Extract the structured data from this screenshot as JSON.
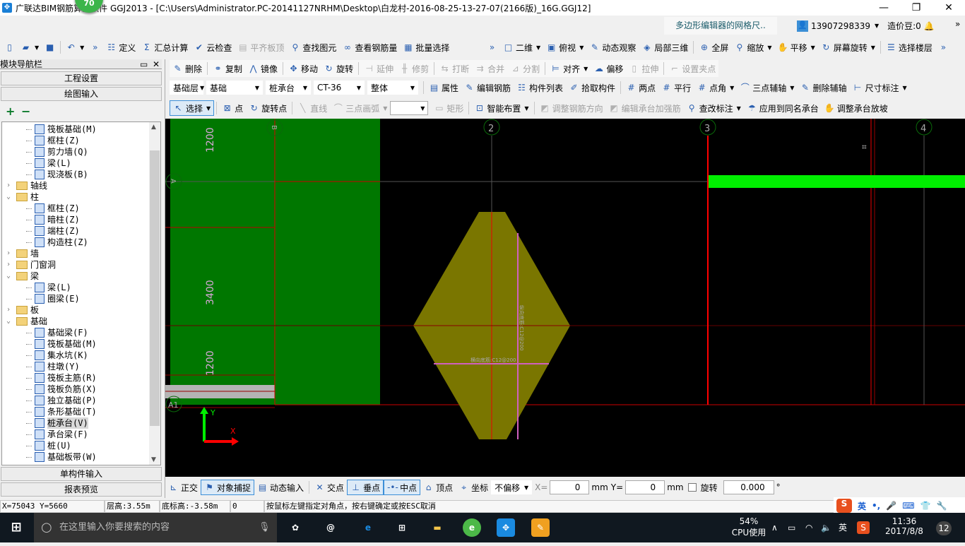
{
  "window": {
    "title": "广联达BIM钢筋算量软件 GGJ2013 - [C:\\Users\\Administrator.PC-20141127NRHM\\Desktop\\白龙村-2016-08-25-13-27-07(2166版)_16G.GGJ12]",
    "badge": "70",
    "minimize": "—",
    "restore": "❐",
    "close": "✕"
  },
  "header": {
    "notice": "多边形编辑器的网格尺..",
    "user": "13907298339",
    "beans": "造价豆:0",
    "more": "»"
  },
  "toolbar1": [
    {
      "id": "new",
      "icon": "▯"
    },
    {
      "id": "open",
      "icon": "▰",
      "dd": true
    },
    {
      "id": "save",
      "icon": "■"
    },
    {
      "sep": true
    },
    {
      "id": "undo",
      "icon": "↶",
      "dd": true
    },
    {
      "id": "more",
      "icon": "»"
    },
    {
      "label": "定义",
      "icon": "☷"
    },
    {
      "label": "汇总计算",
      "icon": "Σ"
    },
    {
      "label": "云检查",
      "icon": "✔"
    },
    {
      "label": "平齐板顶",
      "icon": "▤",
      "dis": true
    },
    {
      "label": "查找图元",
      "icon": "⚲"
    },
    {
      "label": "查看钢筋量",
      "icon": "∞"
    },
    {
      "label": "批量选择",
      "icon": "▦"
    }
  ],
  "toolbar1b": [
    {
      "id": "more",
      "icon": "»"
    },
    {
      "label": "二维",
      "icon": "□",
      "dd": true
    },
    {
      "label": "俯视",
      "icon": "▣",
      "dd": true
    },
    {
      "label": "动态观察",
      "icon": "✎"
    },
    {
      "label": "局部三维",
      "icon": "◈"
    },
    {
      "sep": true
    },
    {
      "label": "全屏",
      "icon": "⊕"
    },
    {
      "label": "缩放",
      "icon": "⚲",
      "dd": true
    },
    {
      "label": "平移",
      "icon": "✋",
      "dd": true
    },
    {
      "label": "屏幕旋转",
      "icon": "↻",
      "dd": true
    },
    {
      "sep": true
    },
    {
      "label": "选择楼层",
      "icon": "☰"
    },
    {
      "id": "more2",
      "icon": "»"
    }
  ],
  "toolbar2": [
    {
      "label": "删除",
      "icon": "✎"
    },
    {
      "sep": true
    },
    {
      "label": "复制",
      "icon": "⚭"
    },
    {
      "label": "镜像",
      "icon": "⋀"
    },
    {
      "sep": true
    },
    {
      "label": "移动",
      "icon": "✥"
    },
    {
      "label": "旋转",
      "icon": "↻"
    },
    {
      "sep": true
    },
    {
      "label": "延伸",
      "icon": "⊣",
      "dis": true
    },
    {
      "label": "修剪",
      "icon": "╫",
      "dis": true
    },
    {
      "sep": true
    },
    {
      "label": "打断",
      "icon": "⇆",
      "dis": true
    },
    {
      "label": "合并",
      "icon": "⇉",
      "dis": true
    },
    {
      "label": "分割",
      "icon": "⊿",
      "dis": true
    },
    {
      "sep": true
    },
    {
      "label": "对齐",
      "icon": "⊨",
      "dd": true
    },
    {
      "label": "偏移",
      "icon": "☁"
    },
    {
      "label": "拉伸",
      "icon": "▯",
      "dis": true
    },
    {
      "sep": true
    },
    {
      "label": "设置夹点",
      "icon": "⌐",
      "dis": true
    }
  ],
  "selects3": [
    "基础层",
    "基础",
    "桩承台",
    "CT-36",
    "整体"
  ],
  "toolbar3": [
    {
      "label": "属性",
      "icon": "▤"
    },
    {
      "label": "编辑钢筋",
      "icon": "✎"
    },
    {
      "label": "构件列表",
      "icon": "☷"
    },
    {
      "label": "拾取构件",
      "icon": "✐"
    },
    {
      "sep": true
    },
    {
      "label": "两点",
      "icon": "#"
    },
    {
      "label": "平行",
      "icon": "#"
    },
    {
      "label": "点角",
      "icon": "#",
      "dd": true
    },
    {
      "label": "三点辅轴",
      "icon": "⌒",
      "dd": true
    },
    {
      "label": "删除辅轴",
      "icon": "✎"
    },
    {
      "label": "尺寸标注",
      "icon": "⊢",
      "dd": true
    }
  ],
  "toolbar4": [
    {
      "label": "选择",
      "icon": "↖",
      "dd": true,
      "on": true
    },
    {
      "sep": true
    },
    {
      "label": "点",
      "icon": "⊠"
    },
    {
      "label": "旋转点",
      "icon": "↻"
    },
    {
      "sep": true
    },
    {
      "label": "直线",
      "icon": "╲",
      "dis": true
    },
    {
      "label": "三点画弧",
      "icon": "⌒",
      "dis": true,
      "dd": true
    },
    {
      "select": ""
    },
    {
      "label": "矩形",
      "icon": "▭",
      "dis": true
    },
    {
      "sep": true
    },
    {
      "label": "智能布置",
      "icon": "⊡",
      "dd": true
    },
    {
      "sep": true
    },
    {
      "label": "调整钢筋方向",
      "icon": "◩",
      "dis": true
    },
    {
      "label": "编辑承台加强筋",
      "icon": "◩",
      "dis": true
    },
    {
      "label": "查改标注",
      "icon": "⚲",
      "dd": true
    },
    {
      "label": "应用到同名承台",
      "icon": "☂"
    },
    {
      "label": "调整承台放坡",
      "icon": "✋"
    }
  ],
  "nav": {
    "title": "模块导航栏",
    "pin": "▭",
    "close": "✕",
    "project_settings": "工程设置",
    "drawing_input": "绘图输入",
    "expand_all": "+",
    "collapse_all": "−",
    "single_input": "单构件输入",
    "report_preview": "报表预览"
  },
  "tree": [
    {
      "label": "筏板基础(M)",
      "level": 2
    },
    {
      "label": "框柱(Z)",
      "level": 2
    },
    {
      "label": "剪力墙(Q)",
      "level": 2
    },
    {
      "label": "梁(L)",
      "level": 2
    },
    {
      "label": "现浇板(B)",
      "level": 2
    },
    {
      "label": "轴线",
      "level": 1,
      "folder": true,
      "expanded": false
    },
    {
      "label": "柱",
      "level": 1,
      "folder": true,
      "expanded": true
    },
    {
      "label": "框柱(Z)",
      "level": 2
    },
    {
      "label": "暗柱(Z)",
      "level": 2
    },
    {
      "label": "端柱(Z)",
      "level": 2
    },
    {
      "label": "构造柱(Z)",
      "level": 2
    },
    {
      "label": "墙",
      "level": 1,
      "folder": true,
      "expanded": false
    },
    {
      "label": "门窗洞",
      "level": 1,
      "folder": true,
      "expanded": false
    },
    {
      "label": "梁",
      "level": 1,
      "folder": true,
      "expanded": true
    },
    {
      "label": "梁(L)",
      "level": 2
    },
    {
      "label": "圈梁(E)",
      "level": 2
    },
    {
      "label": "板",
      "level": 1,
      "folder": true,
      "expanded": false
    },
    {
      "label": "基础",
      "level": 1,
      "folder": true,
      "expanded": true
    },
    {
      "label": "基础梁(F)",
      "level": 2
    },
    {
      "label": "筏板基础(M)",
      "level": 2
    },
    {
      "label": "集水坑(K)",
      "level": 2
    },
    {
      "label": "柱墩(Y)",
      "level": 2
    },
    {
      "label": "筏板主筋(R)",
      "level": 2
    },
    {
      "label": "筏板负筋(X)",
      "level": 2
    },
    {
      "label": "独立基础(P)",
      "level": 2
    },
    {
      "label": "条形基础(T)",
      "level": 2
    },
    {
      "label": "桩承台(V)",
      "level": 2,
      "selected": true
    },
    {
      "label": "承台梁(F)",
      "level": 2
    },
    {
      "label": "桩(U)",
      "level": 2
    },
    {
      "label": "基础板带(W)",
      "level": 2
    }
  ],
  "canvas": {
    "axes": {
      "2": "2",
      "3": "3",
      "4": "4",
      "B": "B",
      "A": "A",
      "A1": "A1"
    },
    "dims": [
      "1200",
      "3400",
      "1200"
    ],
    "rebar_v": "纵向底筋:C12@200",
    "rebar_h": "横向底筋:C12@200",
    "ucs_x": "X",
    "ucs_y": "Y",
    "colors": {
      "slab": "#007700",
      "pilecap": "#7a7600",
      "beam": "#00ee00",
      "axis_red": "#ff0000",
      "rebar": "#d060c0"
    }
  },
  "bottombar": {
    "items": [
      {
        "label": "正交",
        "icon": "⊾"
      },
      {
        "label": "对象捕捉",
        "icon": "⚑",
        "on": true
      },
      {
        "label": "动态输入",
        "icon": "▤"
      },
      {
        "sep": true
      },
      {
        "label": "交点",
        "icon": "✕"
      },
      {
        "label": "垂点",
        "icon": "⊥",
        "on": true
      },
      {
        "label": "中点",
        "icon": "-•-",
        "on": true
      },
      {
        "label": "顶点",
        "icon": "⌂"
      },
      {
        "label": "坐标",
        "icon": "⌖"
      }
    ],
    "offset": "不偏移",
    "x_label": "X=",
    "x": "0",
    "unit": "mm",
    "y_label": "Y=",
    "y": "0",
    "rotate": "旋转",
    "angle": "0.000",
    "deg": "°"
  },
  "status": {
    "coords": "X=75043 Y=5660",
    "floor_height": "层高:3.55m",
    "bottom_elev": "底标高:-3.58m",
    "value": "0",
    "hint": "按鼠标左键指定对角点，按右键确定或按ESC取消"
  },
  "ime": {
    "logo": "S",
    "lang": "英",
    "punct": "•,",
    "mic": "🎤",
    "kbd": "⌨",
    "skin": "👕",
    "tools": "🔧"
  },
  "taskbar": {
    "search": "在这里输入你要搜索的内容",
    "cpu": "54%",
    "cpu_label": "CPU使用",
    "ime": "英",
    "time": "11:36",
    "date": "2017/8/8",
    "notifications": "12"
  }
}
